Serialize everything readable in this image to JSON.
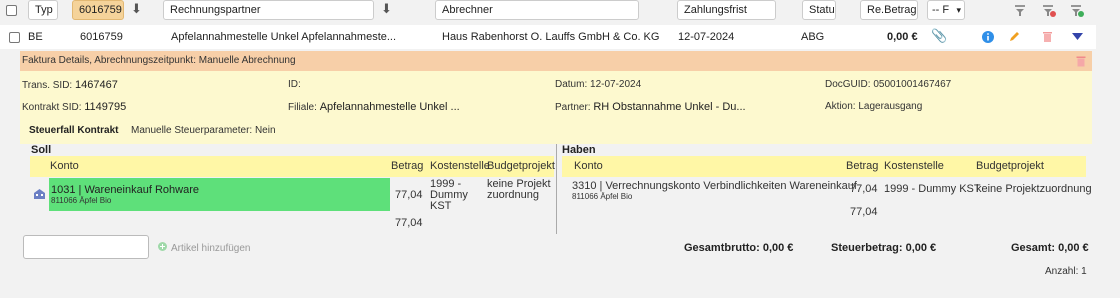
{
  "filters": {
    "typ_label": "Typ",
    "number_value": "6016759",
    "partner_placeholder": "Rechnungspartner",
    "abrechner_placeholder": "Abrechner",
    "zahlungsfrist_placeholder": "Zahlungsfrist",
    "status_placeholder": "Status",
    "rebetrag_placeholder": "Re.Betrag",
    "select_value": "-- F"
  },
  "row": {
    "typ": "BE",
    "number": "6016759",
    "partner": "Apfelannahmestelle Unkel Apfelannahmeste...",
    "abrechner": "Haus Rabenhorst O. Lauffs GmbH & Co. KG",
    "date": "12-07-2024",
    "status": "ABG",
    "amount": "0,00 €"
  },
  "details": {
    "header": "Faktura Details, Abrechnungszeitpunkt: Manuelle Abrechnung",
    "trans_sid_label": "Trans. SID:",
    "trans_sid": "1467467",
    "id_label": "ID:",
    "datum_label": "Datum:",
    "datum": "12-07-2024",
    "docguid_label": "DocGUID:",
    "docguid": "05001001467467",
    "kontrakt_sid_label": "Kontrakt SID:",
    "kontrakt_sid": "1149795",
    "filiale_label": "Filiale:",
    "filiale": "Apfelannahmestelle Unkel ...",
    "partner_label": "Partner:",
    "partner": "RH Obstannahme Unkel - Du...",
    "aktion_label": "Aktion:",
    "aktion": "Lagerausgang",
    "steuerfall_label": "Steuerfall Kontrakt",
    "steuer_param": "Manuelle Steuerparameter: Nein"
  },
  "soll": {
    "title": "Soll",
    "headers": [
      "Konto",
      "Betrag",
      "Kostenstelle",
      "Budgetprojekt"
    ],
    "konto": "1031 | Wareneinkauf Rohware",
    "konto_sub": "811066 Äpfel Bio",
    "betrag": "77,04",
    "kostenstelle": "1999 - Dummy KST",
    "budgetprojekt": "keine Projektzuordnung",
    "total": "77,04"
  },
  "haben": {
    "title": "Haben",
    "headers": [
      "Konto",
      "Betrag",
      "Kostenstelle",
      "Budgetprojekt"
    ],
    "konto": "3310 | Verrechnungskonto Verbindlichkeiten Wareneinkauf",
    "konto_sub": "811066 Äpfel Bio",
    "betrag": "77,04",
    "kostenstelle": "1999 - Dummy KST",
    "budgetprojekt": "keine Projektzuordnung",
    "total": "77,04"
  },
  "footer": {
    "add_label": "Artikel hinzufügen",
    "gesamtbrutto": "Gesamtbrutto: 0,00 €",
    "steuerbetrag": "Steuerbetrag: 0,00 €",
    "gesamt": "Gesamt: 0,00 €",
    "anzahl": "Anzahl: 1"
  },
  "colors": {
    "accent_orange": "#f5d39a",
    "detail_header": "#f7cfa8",
    "detail_body": "#fdf9cf",
    "table_header": "#fff7a6",
    "konto_green": "#5ee07a"
  }
}
